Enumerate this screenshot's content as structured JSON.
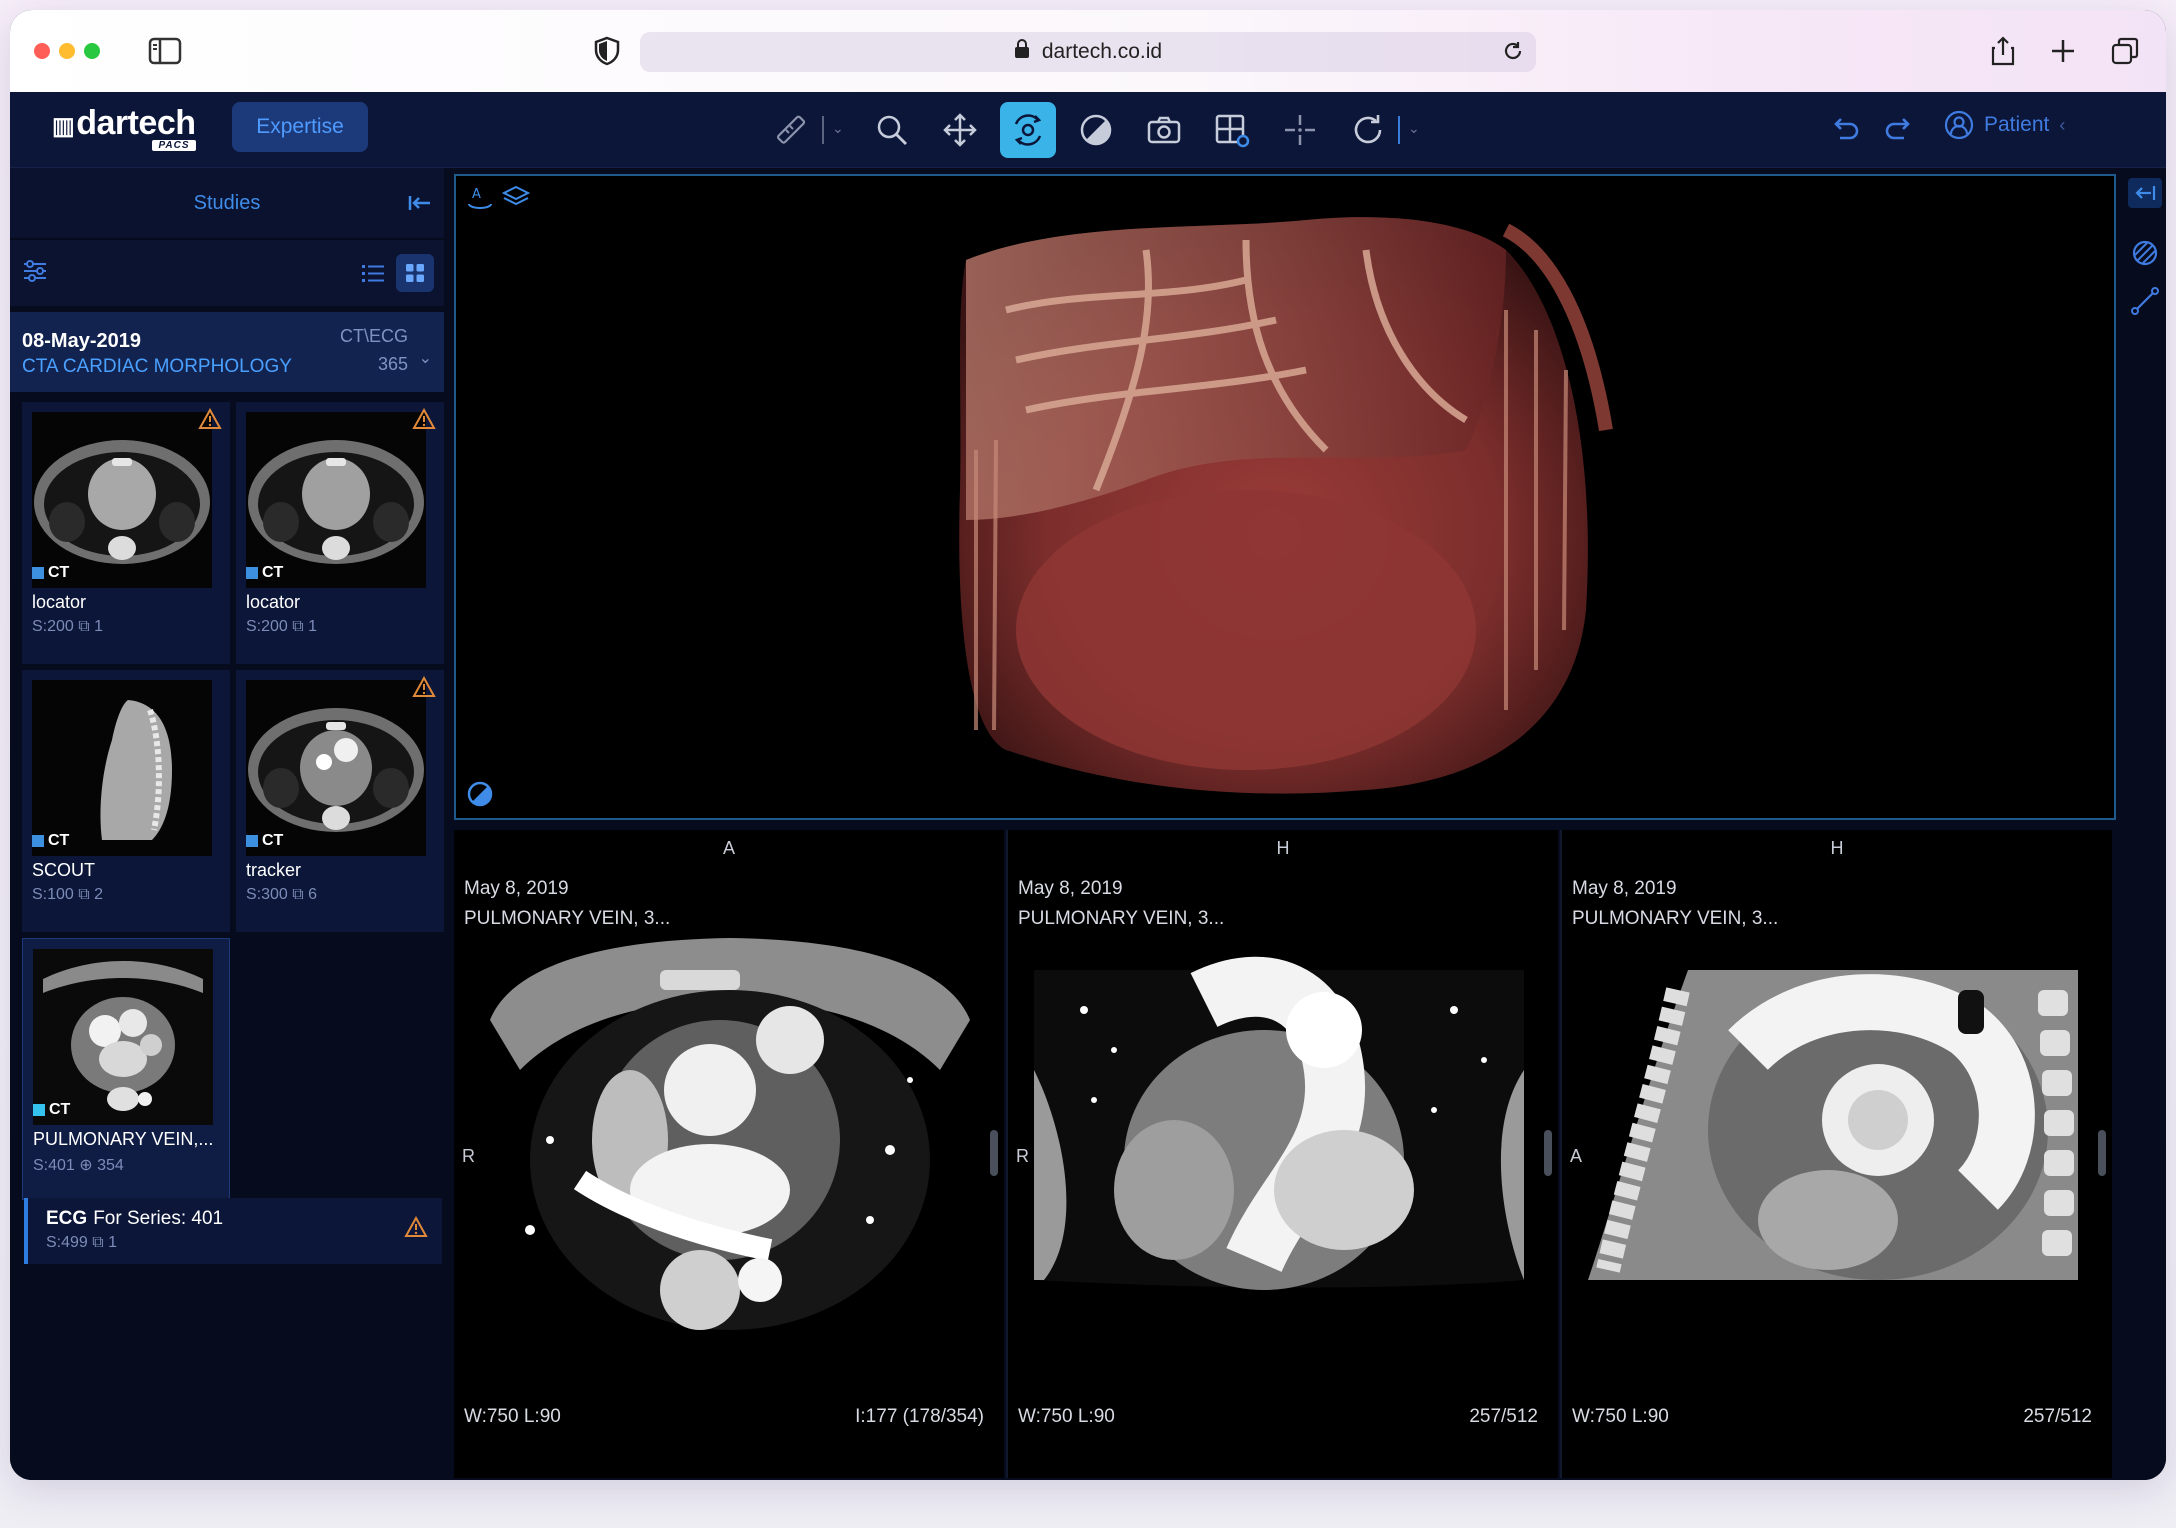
{
  "browser": {
    "url": "dartech.co.id"
  },
  "app": {
    "logo": "dartech",
    "logo_sub": "PACS",
    "mode_button": "Expertise",
    "patient_label": "Patient"
  },
  "toolbar": {
    "tools": [
      "ruler-icon",
      "zoom-icon",
      "pan-icon",
      "rotate-3d-icon",
      "contrast-icon",
      "camera-icon",
      "layout-icon",
      "crosshair-icon",
      "reset-icon"
    ],
    "active_tool": "rotate-3d-icon",
    "accent_color": "#39b3e8"
  },
  "sidebar": {
    "header": "Studies",
    "study": {
      "date": "08-May-2019",
      "description": "CTA CARDIAC MORPHOLOGY",
      "modality": "CT\\ECG",
      "count": "365"
    },
    "series": [
      {
        "modality": "CT",
        "name": "locator",
        "meta": "S:200  ⧉ 1",
        "warning": true
      },
      {
        "modality": "CT",
        "name": "locator",
        "meta": "S:200  ⧉ 1",
        "warning": true
      },
      {
        "modality": "CT",
        "name": "SCOUT",
        "meta": "S:100  ⧉ 2",
        "warning": false
      },
      {
        "modality": "CT",
        "name": "tracker",
        "meta": "S:300  ⧉ 6",
        "warning": true
      },
      {
        "modality": "CT",
        "name": "PULMONARY VEIN,...",
        "meta": "S:401  ⊕ 354",
        "warning": false
      }
    ],
    "ecg": {
      "label": "ECG",
      "title": "For Series: 401",
      "meta": "S:499  ⧉ 1"
    }
  },
  "viewports": [
    {
      "orient_top": "A",
      "orient_left": "R",
      "date": "May 8, 2019",
      "series": "PULMONARY VEIN, 3...",
      "wl": "W:750   L:90",
      "slice": "I:177 (178/354)"
    },
    {
      "orient_top": "H",
      "orient_left": "R",
      "date": "May 8, 2019",
      "series": "PULMONARY VEIN, 3...",
      "wl": "W:750   L:90",
      "slice": "257/512"
    },
    {
      "orient_top": "H",
      "orient_left": "A",
      "date": "May 8, 2019",
      "series": "PULMONARY VEIN, 3...",
      "wl": "W:750   L:90",
      "slice": "257/512"
    }
  ]
}
